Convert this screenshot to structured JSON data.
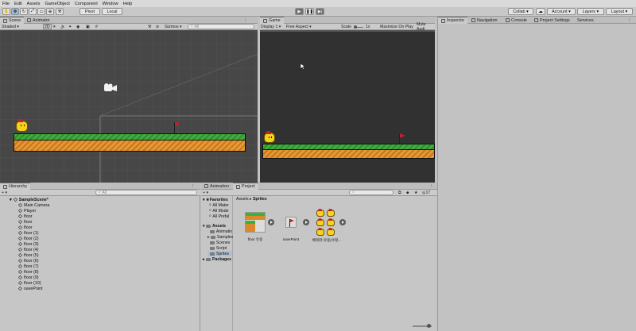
{
  "menu": [
    "File",
    "Edit",
    "Assets",
    "GameObject",
    "Component",
    "Window",
    "Help"
  ],
  "toolbar": {
    "pivot": "Pivot",
    "local": "Local",
    "collab": "Collab",
    "account": "Account",
    "layers": "Layers",
    "layout": "Layout"
  },
  "scene_tabs": [
    "Scene",
    "Animator"
  ],
  "scene_bar": {
    "shading": "Shaded",
    "mode2d": "2D",
    "gizmos": "Gizmos",
    "search_placeholder": "All"
  },
  "game_tab": "Game",
  "game_bar": {
    "display": "Display 1",
    "aspect": "Free Aspect",
    "scale_label": "Scale",
    "scale_value": "1x",
    "maximize": "Maximize On Play",
    "mute": "Mute Audi"
  },
  "inspector_tabs": [
    "Inspector",
    "Navigation",
    "Console",
    "Project Settings",
    "Services"
  ],
  "hierarchy": {
    "tab": "Hierarchy",
    "search_placeholder": "All",
    "scene": "SampleScene*",
    "items": [
      "Main Camera",
      "Player",
      "floor",
      "floor",
      "floor",
      "floor (1)",
      "floor (2)",
      "floor (3)",
      "floor (4)",
      "floor (5)",
      "floor (6)",
      "floor (7)",
      "floor (8)",
      "floor (9)",
      "floor (10)",
      "savePoint"
    ]
  },
  "project": {
    "tabs": [
      "Animation",
      "Project"
    ],
    "breadcrumb": [
      "Assets",
      "Sprites"
    ],
    "count": "17",
    "favorites_label": "Favorites",
    "favorites": [
      "All Mater",
      "All Mode",
      "All Prefal"
    ],
    "assets_label": "Assets",
    "assets_children": [
      "Animatio",
      "Samples",
      "Scenes",
      "Script",
      "Sprites"
    ],
    "packages_label": "Packages",
    "sprites": [
      "floor 유용",
      "savePoint",
      "배워마-유용(수정..."
    ]
  }
}
